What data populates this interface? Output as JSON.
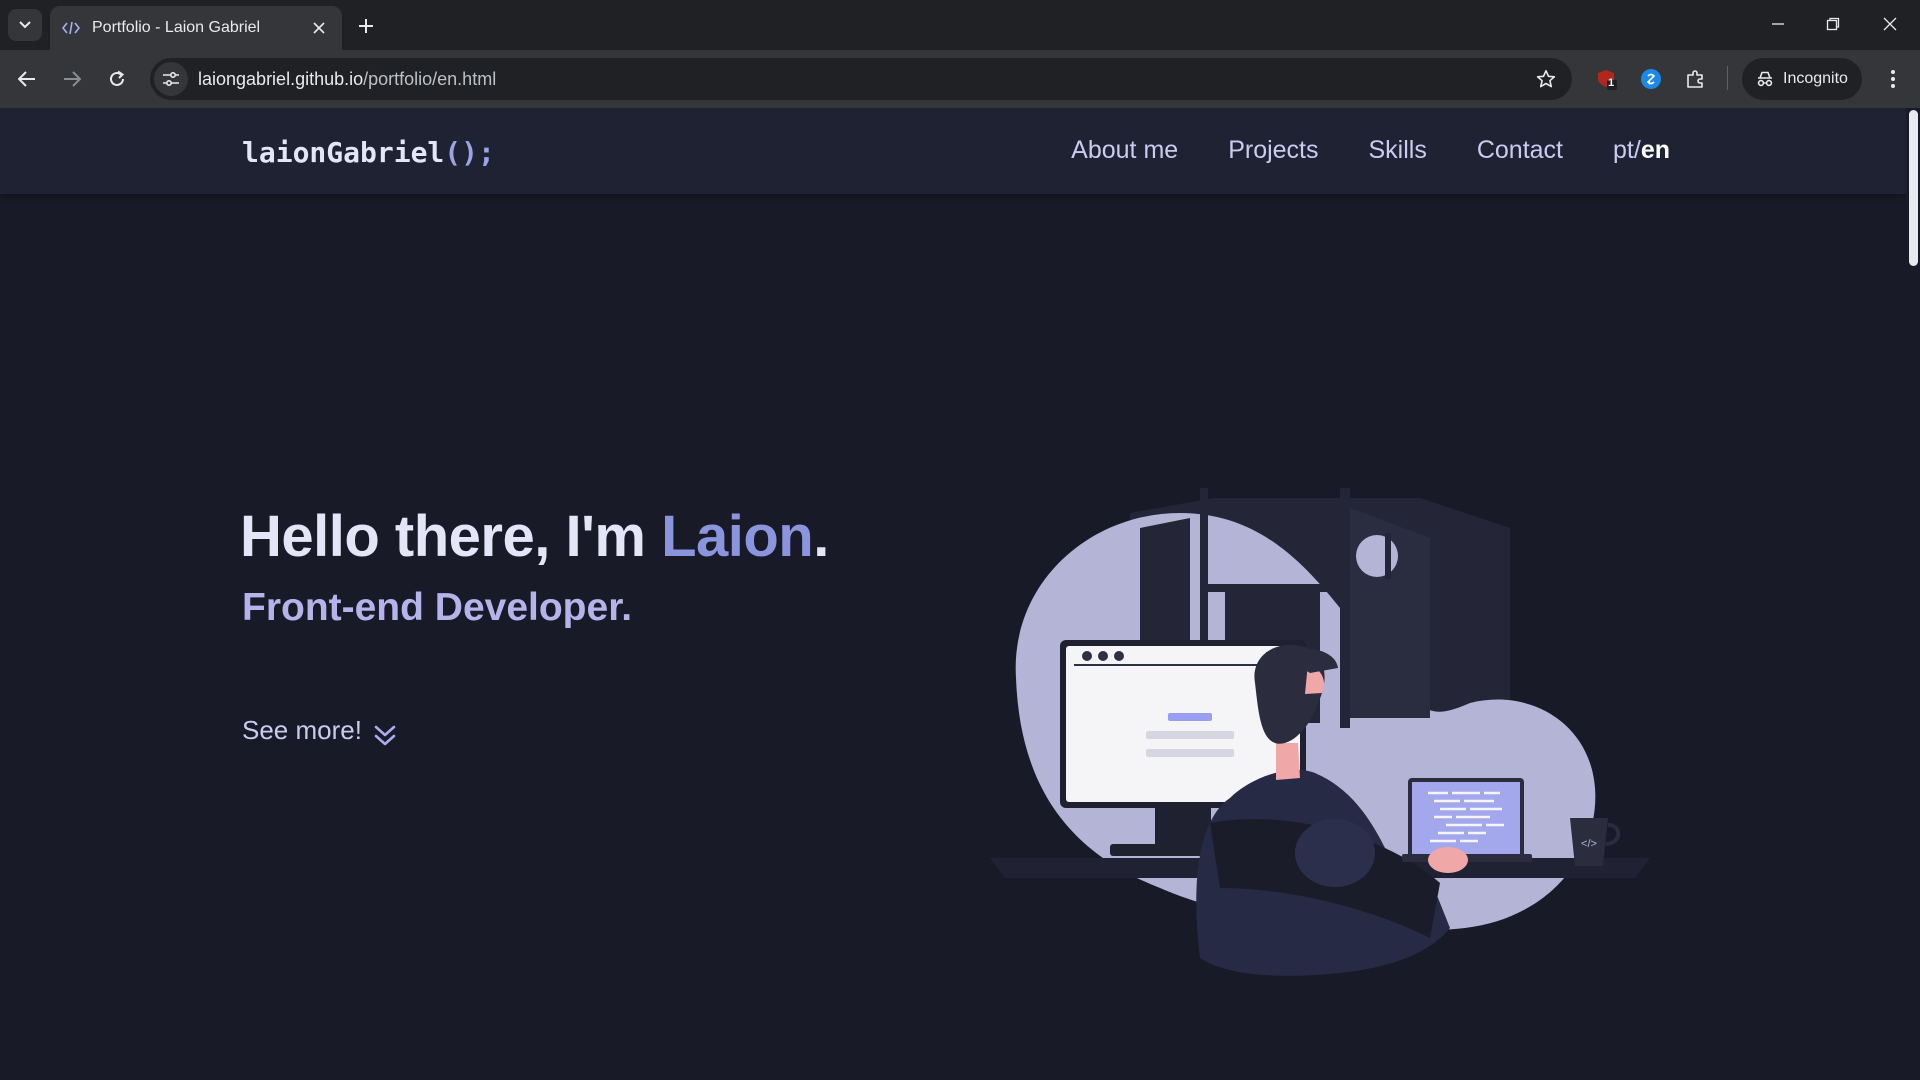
{
  "browser": {
    "tab": {
      "title": "Portfolio - Laion Gabriel",
      "favicon": "code-icon"
    },
    "url": {
      "host": "laiongabriel.github.io",
      "path": "/portfolio/en.html"
    },
    "incognito_label": "Incognito",
    "extension_badge": "1"
  },
  "site": {
    "logo": {
      "name": "laionGabriel",
      "suffix": "();"
    },
    "nav": [
      {
        "label": "About me"
      },
      {
        "label": "Projects"
      },
      {
        "label": "Skills"
      },
      {
        "label": "Contact"
      }
    ],
    "lang": {
      "inactive": "pt/",
      "active": "en"
    },
    "hero": {
      "greeting": "Hello there, I'm ",
      "name": "Laion",
      "period": ".",
      "role": "Front-end Developer.",
      "see_more": "See more!"
    },
    "illustration_code_label": "</>"
  },
  "colors": {
    "page_bg": "#181a28",
    "header_bg": "#1f2233",
    "accent": "#8b95de",
    "subtitle": "#b5b4ea",
    "illustration_blob": "#b3b4d6"
  }
}
